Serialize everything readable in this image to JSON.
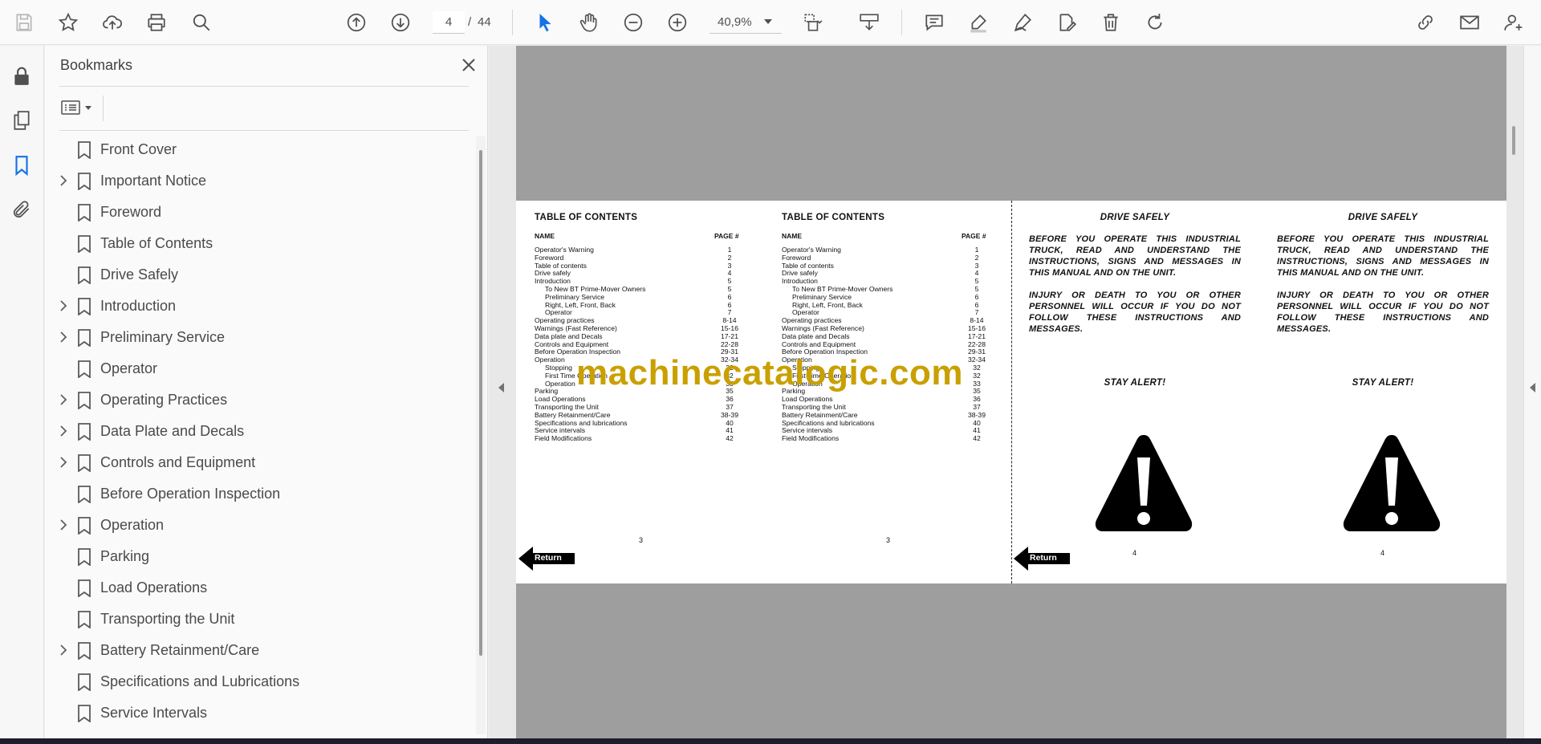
{
  "toolbar": {
    "page_current": "4",
    "page_separator": "/",
    "page_total": "44",
    "zoom": "40,9%"
  },
  "bookmarks": {
    "title": "Bookmarks",
    "items": [
      {
        "label": "Front Cover",
        "expandable": false
      },
      {
        "label": "Important Notice",
        "expandable": true
      },
      {
        "label": "Foreword",
        "expandable": false
      },
      {
        "label": "Table of Contents",
        "expandable": false
      },
      {
        "label": "Drive Safely",
        "expandable": false
      },
      {
        "label": "Introduction",
        "expandable": true
      },
      {
        "label": "Preliminary Service",
        "expandable": true
      },
      {
        "label": "Operator",
        "expandable": false
      },
      {
        "label": "Operating Practices",
        "expandable": true
      },
      {
        "label": "Data Plate and Decals",
        "expandable": true
      },
      {
        "label": "Controls and Equipment",
        "expandable": true
      },
      {
        "label": "Before Operation Inspection",
        "expandable": false
      },
      {
        "label": "Operation",
        "expandable": true
      },
      {
        "label": "Parking",
        "expandable": false
      },
      {
        "label": "Load Operations",
        "expandable": false
      },
      {
        "label": "Transporting the Unit",
        "expandable": false
      },
      {
        "label": "Battery Retainment/Care",
        "expandable": true
      },
      {
        "label": "Specifications and Lubrications",
        "expandable": false
      },
      {
        "label": "Service Intervals",
        "expandable": false
      }
    ]
  },
  "document": {
    "toc": {
      "title": "TABLE OF CONTENTS",
      "name_header": "NAME",
      "page_header": "PAGE #",
      "rows": [
        {
          "name": "Operator's Warning",
          "page": "1",
          "sub": false
        },
        {
          "name": "Foreword",
          "page": "2",
          "sub": false
        },
        {
          "name": "Table of contents",
          "page": "3",
          "sub": false
        },
        {
          "name": "Drive safely",
          "page": "4",
          "sub": false
        },
        {
          "name": "Introduction",
          "page": "5",
          "sub": false
        },
        {
          "name": "To New BT Prime-Mover Owners",
          "page": "5",
          "sub": true
        },
        {
          "name": "Preliminary Service",
          "page": "6",
          "sub": true
        },
        {
          "name": "Right, Left, Front, Back",
          "page": "6",
          "sub": true
        },
        {
          "name": "Operator",
          "page": "7",
          "sub": true
        },
        {
          "name": "Operating practices",
          "page": "8-14",
          "sub": false
        },
        {
          "name": "Warnings (Fast Reference)",
          "page": "15-16",
          "sub": false
        },
        {
          "name": "Data plate and Decals",
          "page": "17-21",
          "sub": false
        },
        {
          "name": "Controls and Equipment",
          "page": "22-28",
          "sub": false
        },
        {
          "name": "Before Operation Inspection",
          "page": "29-31",
          "sub": false
        },
        {
          "name": "Operation",
          "page": "32-34",
          "sub": false
        },
        {
          "name": "Stopping",
          "page": "32",
          "sub": true
        },
        {
          "name": "First Time Operation",
          "page": "32",
          "sub": true
        },
        {
          "name": "Operation",
          "page": "33",
          "sub": true
        },
        {
          "name": "Parking",
          "page": "35",
          "sub": false
        },
        {
          "name": "Load Operations",
          "page": "36",
          "sub": false
        },
        {
          "name": "Transporting the Unit",
          "page": "37",
          "sub": false
        },
        {
          "name": "Battery Retainment/Care",
          "page": "38-39",
          "sub": false
        },
        {
          "name": "Specifications and lubrications",
          "page": "40",
          "sub": false
        },
        {
          "name": "Service intervals",
          "page": "41",
          "sub": false
        },
        {
          "name": "Field Modifications",
          "page": "42",
          "sub": false
        }
      ],
      "page_number": "3"
    },
    "safety": {
      "title": "DRIVE SAFELY",
      "para1": "BEFORE YOU OPERATE THIS INDUSTRIAL TRUCK, READ AND UNDERSTAND THE INSTRUCTIONS, SIGNS AND MESSAGES IN THIS MANUAL AND ON THE UNIT.",
      "para2": "INJURY OR DEATH TO YOU OR OTHER PERSONNEL WILL OCCUR IF YOU DO NOT FOLLOW THESE INSTRUCTIONS AND MESSAGES.",
      "alert": "STAY ALERT!",
      "page_number": "4"
    },
    "return_label": "Return",
    "watermark": "machinecatalogic.com"
  },
  "colors": {
    "accent_blue": "#1473e6",
    "watermark": "#c9a000",
    "canvas_gray": "#9e9e9e"
  }
}
